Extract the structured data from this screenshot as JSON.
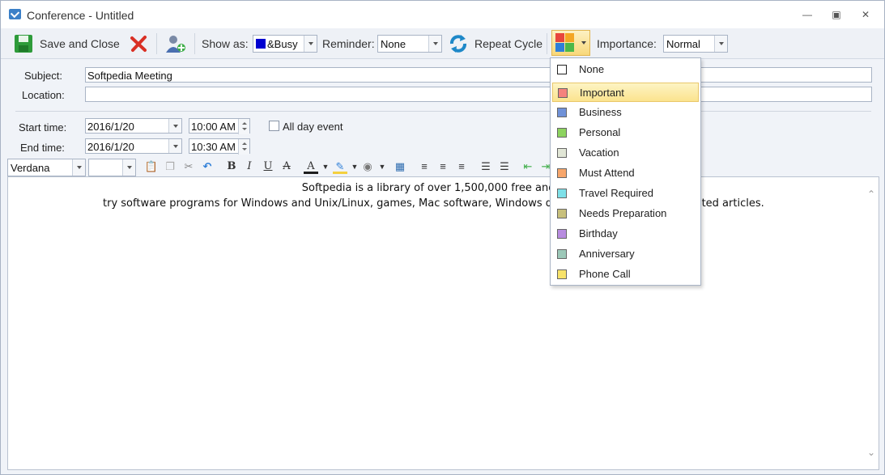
{
  "window": {
    "title": "Conference - Untitled"
  },
  "toolbar": {
    "save_close_label": "Save and Close",
    "show_as_label": "Show as:",
    "show_as_value": "&Busy",
    "show_as_color": "#0000d0",
    "reminder_label": "Reminder:",
    "reminder_value": "None",
    "repeat_label": "Repeat Cycle",
    "importance_label": "Importance:",
    "importance_value": "Normal"
  },
  "form": {
    "subject_label": "Subject:",
    "subject_value": "Softpedia Meeting",
    "location_label": "Location:",
    "location_value": "",
    "start_label": "Start time:",
    "start_date": "2016/1/20",
    "start_time": "10:00 AM",
    "end_label": "End time:",
    "end_date": "2016/1/20",
    "end_time": "10:30 AM",
    "all_day_label": "All day event"
  },
  "format": {
    "font_name": "Verdana",
    "font_size": ""
  },
  "editor": {
    "line1": "Softpedia is a library of over 1,500,000 free and fre",
    "line2": "try software programs for Windows and Unix/Linux, games, Mac software, Windows driv",
    "line2_tail": "lated articles."
  },
  "category_menu": {
    "items": [
      {
        "label": "None",
        "color": "#ffffff"
      },
      {
        "label": "Important",
        "color": "#f4837d"
      },
      {
        "label": "Business",
        "color": "#7092d8"
      },
      {
        "label": "Personal",
        "color": "#8dd35f"
      },
      {
        "label": "Vacation",
        "color": "#e1e6d6"
      },
      {
        "label": "Must Attend",
        "color": "#f7a66b"
      },
      {
        "label": "Travel Required",
        "color": "#7ee0e8"
      },
      {
        "label": "Needs Preparation",
        "color": "#c8c07c"
      },
      {
        "label": "Birthday",
        "color": "#b88ce0"
      },
      {
        "label": "Anniversary",
        "color": "#9cc8b8"
      },
      {
        "label": "Phone Call",
        "color": "#f7e26a"
      }
    ],
    "highlighted": "Important"
  }
}
